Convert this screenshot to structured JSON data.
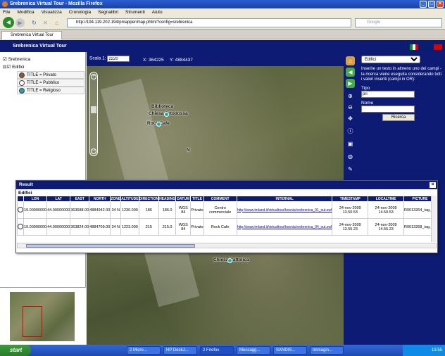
{
  "window": {
    "title": "Srebrenica Virtual Tour - Mozilla Firefox"
  },
  "menu": [
    "File",
    "Modifica",
    "Visualizza",
    "Cronologia",
    "Segnalibri",
    "Strumenti",
    "Aiuto"
  ],
  "nav": {
    "url": "http://194.119.202.194/pmapper/map.phtml?config=srebrenica",
    "search_placeholder": "Google"
  },
  "tab": {
    "label": "Srebrenica Virtual Tour"
  },
  "app": {
    "title": "Srebrenica Virtual Tour"
  },
  "tree": {
    "root": "Srebrenica",
    "layer": "Edifici",
    "legend": [
      "TITLE = Privato",
      "TITLE = Pubblico",
      "TITLE = Religioso"
    ],
    "legend_colors": [
      "#8a5a3a",
      "#ffffff",
      "#2aa0a0"
    ]
  },
  "map": {
    "scale_label": "Scala 1:",
    "scale_value": "2220",
    "x_label": "X:",
    "x_value": "364225",
    "y_label": "Y:",
    "y_value": "4884437",
    "labels": {
      "bibl": "Biblioteca",
      "chiesa_o": "Chiesa Ortodossa",
      "rock": "Rock Cafe",
      "n": "N",
      "chiesa_c": "Chiesa Cattolica"
    }
  },
  "search_panel": {
    "layer": "Edifici",
    "instructions": "Inserire un testo in almeno uno dei campi - la ricerca viene eseguita considerando tutti i valori inseriti (campi in OR):",
    "tipo_label": "Tipo",
    "tipo_value": "pri",
    "nome_label": "Nome",
    "nome_value": "",
    "button": "Ricerca"
  },
  "result": {
    "title": "Result",
    "layer": "Edifici",
    "columns": [
      "",
      "LON",
      "LAT",
      "EAST",
      "NORTH",
      "ZONE",
      "ALTITUDE",
      "DIRECTION",
      "HEADING",
      "DATUM",
      "TITLE",
      "COMMENT",
      "INTERNAL",
      "TIMESTAMP",
      "LOCALTIME",
      "PICTURE"
    ],
    "rows": [
      [
        "19.00000000",
        "44.00000000",
        "363688.00",
        "4884942.00",
        "34 N",
        "1230.000",
        "186",
        "186.0",
        "WGS 84",
        "Privato",
        "Centro commerciale",
        "http://www.tmland.it/virtualtour/bosnia/srebrenica_01_out.swf",
        "24-nov-2009 13.50.53",
        "24-nov-2009 14.50.53",
        "R0013264_tag.jpg"
      ],
      [
        "19.00000000",
        "44.00000000",
        "363824.00",
        "4884709.00",
        "34 N",
        "1223.000",
        "215",
        "215.0",
        "WGS 84",
        "Privato",
        "Rock Cafe",
        "http://www.tmland.it/virtualtour/bosnia/srebrenica_04_out.swf",
        "24-nov-2009 13.55.23",
        "24-nov-2009 14.55.23",
        "R0013268_tag.jpg"
      ]
    ]
  },
  "taskbar": {
    "start": "start",
    "tasks": [
      "2 Micro...",
      "HP DeskJ...",
      "2 Firefox",
      "Messagg...",
      "SANDIS...",
      "Immagin..."
    ],
    "clock": "13.55"
  }
}
